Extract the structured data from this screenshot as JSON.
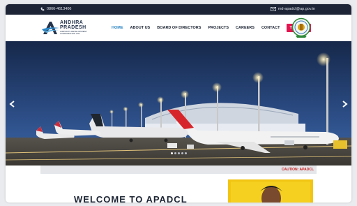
{
  "topbar": {
    "phone_icon": "phone-icon",
    "phone": "0866-4613406",
    "mail_icon": "mail-icon",
    "email": "md-apadcl@ap.gov.in"
  },
  "header": {
    "logo": {
      "line1": "ANDHRA",
      "line2": "PRADESH",
      "line3": "AIRPORTS DEVELOPMENT CORPORATION LTD."
    },
    "nav": [
      {
        "label": "HOME"
      },
      {
        "label": "ABOUT US"
      },
      {
        "label": "BOARD OF DIRECTORS"
      },
      {
        "label": "PROJECTS"
      },
      {
        "label": "CAREERS"
      },
      {
        "label": "CONTACT"
      },
      {
        "label": "TENDERS"
      }
    ],
    "emblem_icon": "state-emblem-icon"
  },
  "hero": {
    "prev_icon": "chevron-left-icon",
    "next_icon": "chevron-right-icon",
    "dots": 5,
    "active_dot": 1
  },
  "caution": {
    "text": "CAUTION: APADCL"
  },
  "welcome": {
    "title": "WELCOME TO APADCL"
  },
  "colors": {
    "topbar_bg": "#1d2436",
    "nav_active": "#2a84c4",
    "tenders_bg": "#e3154f",
    "caution_text": "#c61c1c",
    "portrait_bg": "#f2c513"
  }
}
